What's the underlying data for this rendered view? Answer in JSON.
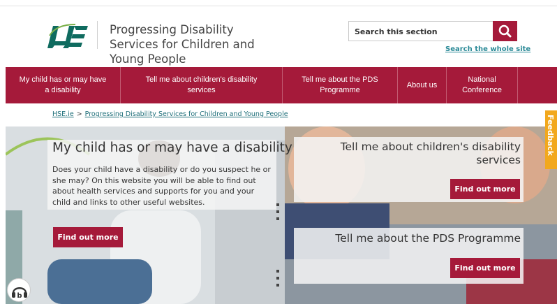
{
  "header": {
    "logo_text": "HSE",
    "site_title": "Progressing Disability Services for Children and Young People",
    "search_placeholder": "Search this section",
    "search_whole_site": "Search the whole site"
  },
  "nav": {
    "items": [
      {
        "label": "My child has or may have a disability"
      },
      {
        "label": "Tell me about children's disability services"
      },
      {
        "label": "Tell me about the PDS Programme"
      },
      {
        "label": "About us"
      },
      {
        "label": "National Conference"
      }
    ]
  },
  "breadcrumb": {
    "items": [
      "HSE.ie",
      "Progressing Disability Services for Children and Young People"
    ],
    "separator": ">"
  },
  "hero": {
    "left": {
      "title": "My child has or may have a disability",
      "body": "Does your child have a disability or do you suspect he or she may? On this website you will be able to find out about health services and supports for you and your child and links to other useful websites.",
      "button": "Find out more"
    },
    "right_top": {
      "title": "Tell me about children's disability services",
      "button": "Find out more"
    },
    "right_bottom": {
      "title": "Tell me about the PDS Programme",
      "button": "Find out more"
    }
  },
  "feedback": {
    "label": "Feedback"
  },
  "icons": {
    "search": "search-icon",
    "listen": "headphones-icon"
  },
  "colors": {
    "brand": "#a51a3a",
    "link": "#1f6f7a",
    "feedback": "#f2a81d"
  }
}
